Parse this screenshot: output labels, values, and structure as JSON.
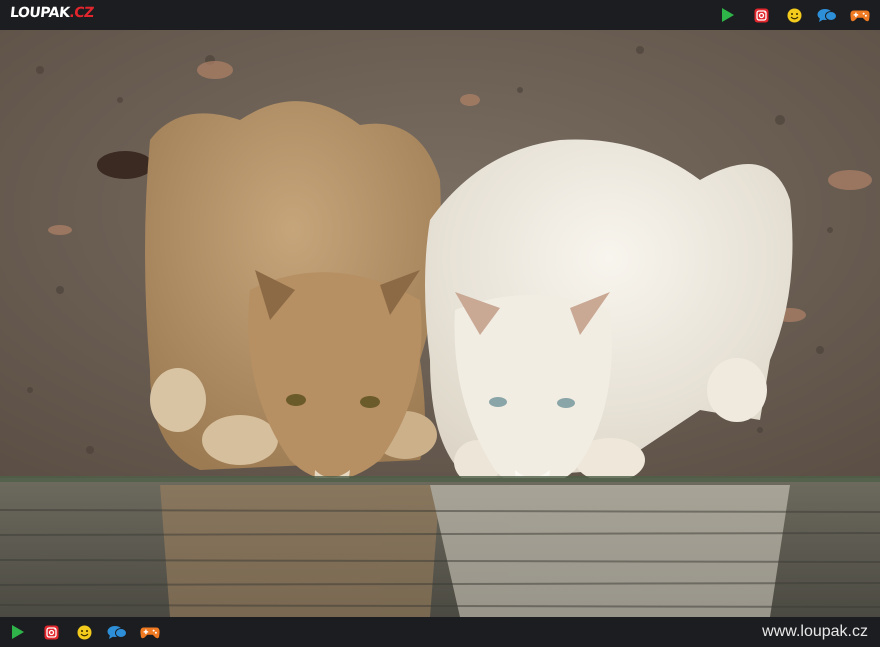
{
  "header": {
    "logo_main": "LOUPAK",
    "logo_tld": ".CZ"
  },
  "footer": {
    "site_url": "www.loupak.cz"
  },
  "icons": [
    "play-icon",
    "instagram-icon",
    "smiley-icon",
    "chat-icon",
    "gamepad-icon"
  ],
  "colors": {
    "bar_background": "#1c1d20",
    "play": "#2fb44a",
    "instagram": "#e2262d",
    "smiley": "#f3cb1c",
    "chat": "#2e8fd9",
    "gamepad": "#f07a22"
  },
  "photo": {
    "subject": "two lionesses drinking from a waterhole"
  }
}
